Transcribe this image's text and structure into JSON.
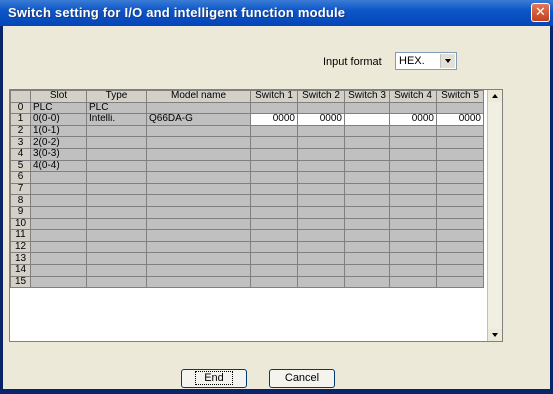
{
  "window": {
    "title": "Switch setting for I/O and intelligent function module"
  },
  "input_format": {
    "label": "Input format",
    "value": "HEX."
  },
  "grid": {
    "headers": [
      "Slot",
      "Type",
      "Model name",
      "Switch 1",
      "Switch 2",
      "Switch 3",
      "Switch 4",
      "Switch 5"
    ],
    "rows": [
      {
        "num": "0",
        "slot": "PLC",
        "type": "PLC",
        "model": "",
        "sw": [
          "",
          "",
          "",
          "",
          ""
        ]
      },
      {
        "num": "1",
        "slot": "0(0-0)",
        "type": "Intelli.",
        "model": "Q66DA-G",
        "sw": [
          "0000",
          "0000",
          "",
          "0000",
          "0000"
        ]
      },
      {
        "num": "2",
        "slot": "1(0-1)",
        "type": "",
        "model": "",
        "sw": [
          "",
          "",
          "",
          "",
          ""
        ]
      },
      {
        "num": "3",
        "slot": "2(0-2)",
        "type": "",
        "model": "",
        "sw": [
          "",
          "",
          "",
          "",
          ""
        ]
      },
      {
        "num": "4",
        "slot": "3(0-3)",
        "type": "",
        "model": "",
        "sw": [
          "",
          "",
          "",
          "",
          ""
        ]
      },
      {
        "num": "5",
        "slot": "4(0-4)",
        "type": "",
        "model": "",
        "sw": [
          "",
          "",
          "",
          "",
          ""
        ]
      },
      {
        "num": "6",
        "slot": "",
        "type": "",
        "model": "",
        "sw": [
          "",
          "",
          "",
          "",
          ""
        ]
      },
      {
        "num": "7",
        "slot": "",
        "type": "",
        "model": "",
        "sw": [
          "",
          "",
          "",
          "",
          ""
        ]
      },
      {
        "num": "8",
        "slot": "",
        "type": "",
        "model": "",
        "sw": [
          "",
          "",
          "",
          "",
          ""
        ]
      },
      {
        "num": "9",
        "slot": "",
        "type": "",
        "model": "",
        "sw": [
          "",
          "",
          "",
          "",
          ""
        ]
      },
      {
        "num": "10",
        "slot": "",
        "type": "",
        "model": "",
        "sw": [
          "",
          "",
          "",
          "",
          ""
        ]
      },
      {
        "num": "11",
        "slot": "",
        "type": "",
        "model": "",
        "sw": [
          "",
          "",
          "",
          "",
          ""
        ]
      },
      {
        "num": "12",
        "slot": "",
        "type": "",
        "model": "",
        "sw": [
          "",
          "",
          "",
          "",
          ""
        ]
      },
      {
        "num": "13",
        "slot": "",
        "type": "",
        "model": "",
        "sw": [
          "",
          "",
          "",
          "",
          ""
        ]
      },
      {
        "num": "14",
        "slot": "",
        "type": "",
        "model": "",
        "sw": [
          "",
          "",
          "",
          "",
          ""
        ]
      },
      {
        "num": "15",
        "slot": "",
        "type": "",
        "model": "",
        "sw": [
          "",
          "",
          "",
          "",
          ""
        ]
      }
    ]
  },
  "buttons": {
    "end": "End",
    "cancel": "Cancel"
  }
}
